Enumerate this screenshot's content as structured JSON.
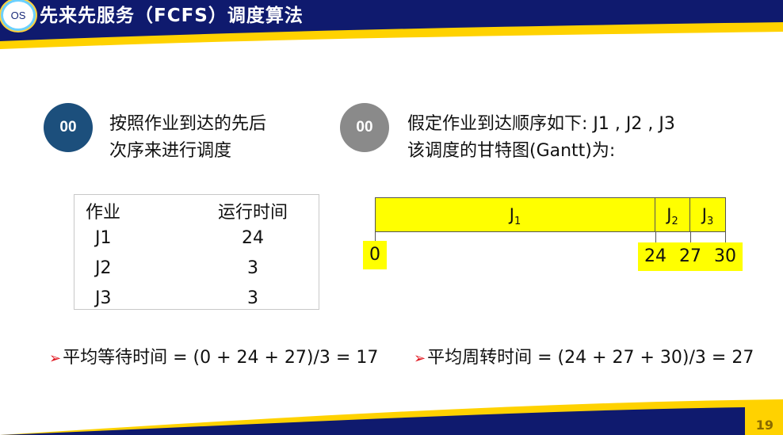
{
  "header": {
    "logo_text": "OS",
    "title": "先来先服务（FCFS）调度算法"
  },
  "point1": {
    "badge": "00",
    "line1": "按照作业到达的先后",
    "line2": "次序来进行调度"
  },
  "point2": {
    "badge": "00",
    "line1": "假定作业到达顺序如下: J1 , J2 , J3",
    "line2": "该调度的甘特图(Gantt)为:"
  },
  "jobs_table": {
    "headers": [
      "作业",
      "运行时间"
    ],
    "rows": [
      [
        "J1",
        "24"
      ],
      [
        "J2",
        "3"
      ],
      [
        "J3",
        "3"
      ]
    ]
  },
  "gantt": {
    "segments": [
      {
        "label": "J",
        "sub": "1",
        "start": 0,
        "end": 24
      },
      {
        "label": "J",
        "sub": "2",
        "start": 24,
        "end": 27
      },
      {
        "label": "J",
        "sub": "3",
        "start": 27,
        "end": 30
      }
    ],
    "ticks": [
      "0",
      "24",
      "27",
      "30"
    ]
  },
  "averages": {
    "wait": "平均等待时间 = (0 + 24 + 27)/3 = 17",
    "turnaround": "平均周转时间 = (24 + 27 + 30)/3 = 27"
  },
  "page_number": "19",
  "colors": {
    "header_navy": "#0f1a6e",
    "accent_yellow": "#ffd200",
    "gantt_fill": "#ffff00"
  }
}
